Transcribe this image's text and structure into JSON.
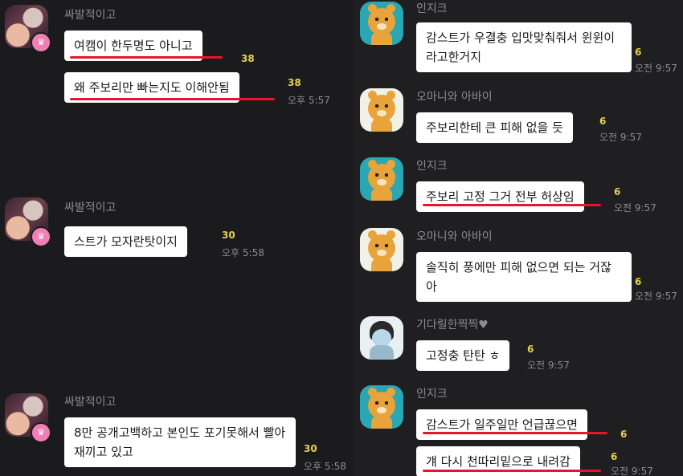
{
  "left": {
    "groups": [
      {
        "sender": "싸발적이고",
        "messages": [
          {
            "text": "여캠이 한두명도 아니고",
            "unread": "38",
            "time": ""
          },
          {
            "text": "왜 주보리만 빠는지도 이해안됨",
            "unread": "38",
            "time": "오후 5:57"
          }
        ]
      },
      {
        "sender": "싸발적이고",
        "messages": [
          {
            "text": "스트가 모자란탓이지",
            "unread": "30",
            "time": "오후 5:58"
          }
        ]
      },
      {
        "sender": "싸발적이고",
        "messages": [
          {
            "text": "8만 공개고백하고 본인도 포기못해서 빨아재끼고 있고",
            "unread": "30",
            "time": "오후 5:58"
          }
        ]
      }
    ]
  },
  "right": {
    "groups": [
      {
        "sender": "인지크",
        "text": "감스트가 우결충 입맛맞춰줘서 윈윈이라고한거지",
        "unread": "6",
        "time": "오전 9:57"
      },
      {
        "sender": "오마니와 아바이",
        "text": "주보리한테 큰 피해 없을 듯",
        "unread": "6",
        "time": "오전 9:57"
      },
      {
        "sender": "인지크",
        "text": "주보리 고정 그거 전부 허상임",
        "unread": "6",
        "time": "오전 9:57"
      },
      {
        "sender": "오마니와 아바이",
        "text": "솔직히 풍에만 피해 없으면 되는 거잖아",
        "unread": "6",
        "time": "오전 9:57"
      },
      {
        "sender": "기다릴한찍찍♥",
        "text": "고정충 탄탄 ㅎ",
        "unread": "6",
        "time": "오전 9:57"
      },
      {
        "sender": "인지크",
        "text": "감스트가 일주일만 언급끊으면",
        "unread": "6",
        "time": ""
      },
      {
        "sender": "",
        "text": "걔 다시 천따리밑으로 내려감",
        "unread": "6",
        "time": "오전 9:57"
      }
    ]
  },
  "icons": {
    "crown": "crown-icon",
    "avatar_person": "profile-photo",
    "avatar_bear": "bear-character",
    "avatar_kid": "kid-character"
  },
  "colors": {
    "bubble": "#ffffff",
    "underline": "#e8142a",
    "unread": "#e6d04a",
    "background": "#1c1c1e"
  }
}
